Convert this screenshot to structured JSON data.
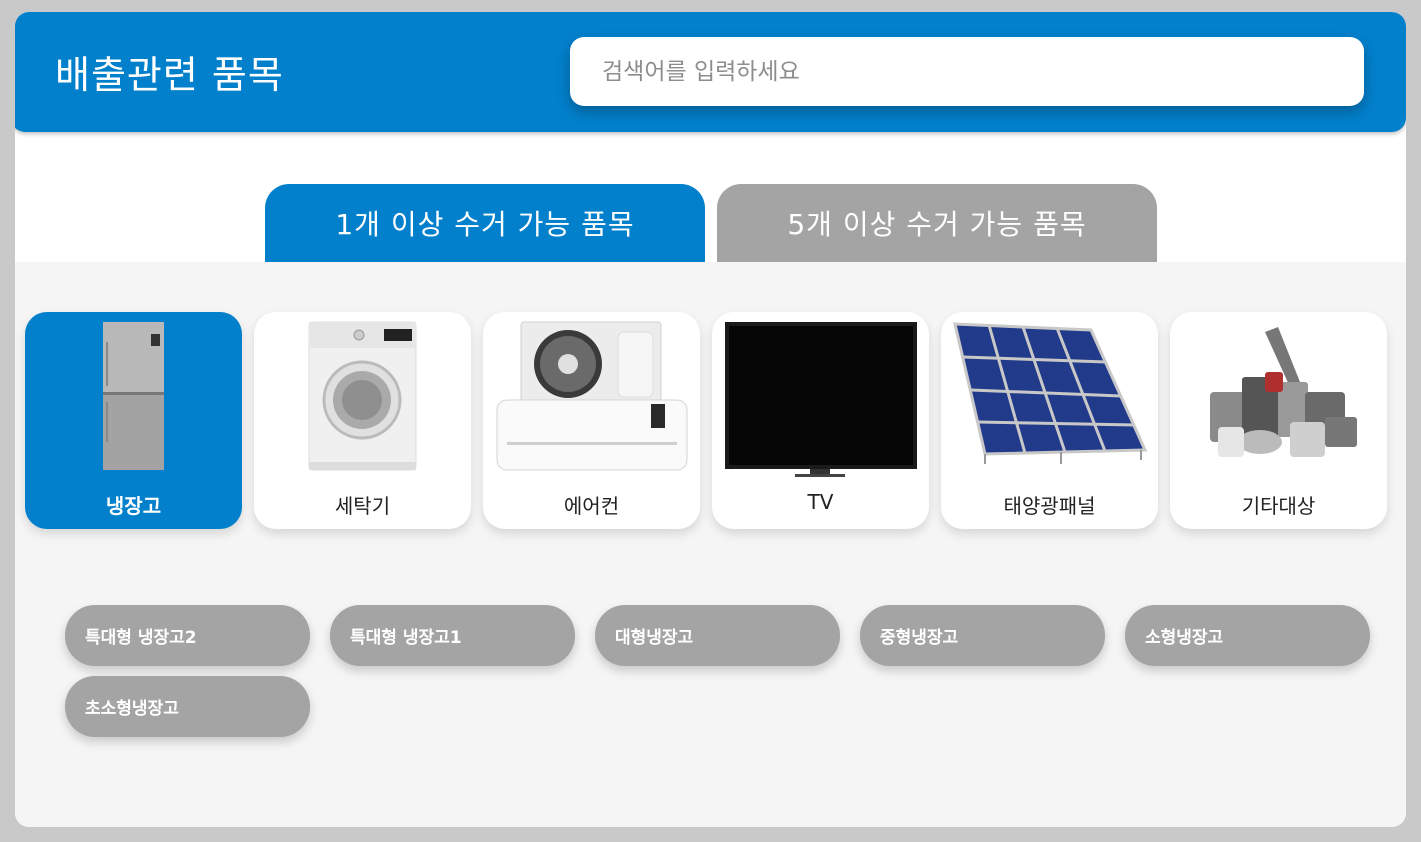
{
  "header": {
    "title": "배출관련 품목",
    "search_placeholder": "검색어를 입력하세요"
  },
  "tabs": [
    {
      "label": "1개 이상 수거 가능 품목",
      "active": true
    },
    {
      "label": "5개 이상 수거 가능 품목",
      "active": false
    }
  ],
  "categories": [
    {
      "label": "냉장고",
      "icon": "refrigerator-icon",
      "selected": true
    },
    {
      "label": "세탁기",
      "icon": "washing-machine-icon",
      "selected": false
    },
    {
      "label": "에어컨",
      "icon": "air-conditioner-icon",
      "selected": false
    },
    {
      "label": "TV",
      "icon": "tv-icon",
      "selected": false
    },
    {
      "label": "태양광패널",
      "icon": "solar-panel-icon",
      "selected": false
    },
    {
      "label": "기타대상",
      "icon": "misc-appliances-icon",
      "selected": false
    }
  ],
  "items": [
    {
      "label": "특대형 냉장고2"
    },
    {
      "label": "특대형 냉장고1"
    },
    {
      "label": "대형냉장고"
    },
    {
      "label": "중형냉장고"
    },
    {
      "label": "소형냉장고"
    },
    {
      "label": "초소형냉장고"
    }
  ],
  "colors": {
    "accent": "#0380cc",
    "inactive": "#a4a4a4",
    "background": "#f5f5f5"
  }
}
